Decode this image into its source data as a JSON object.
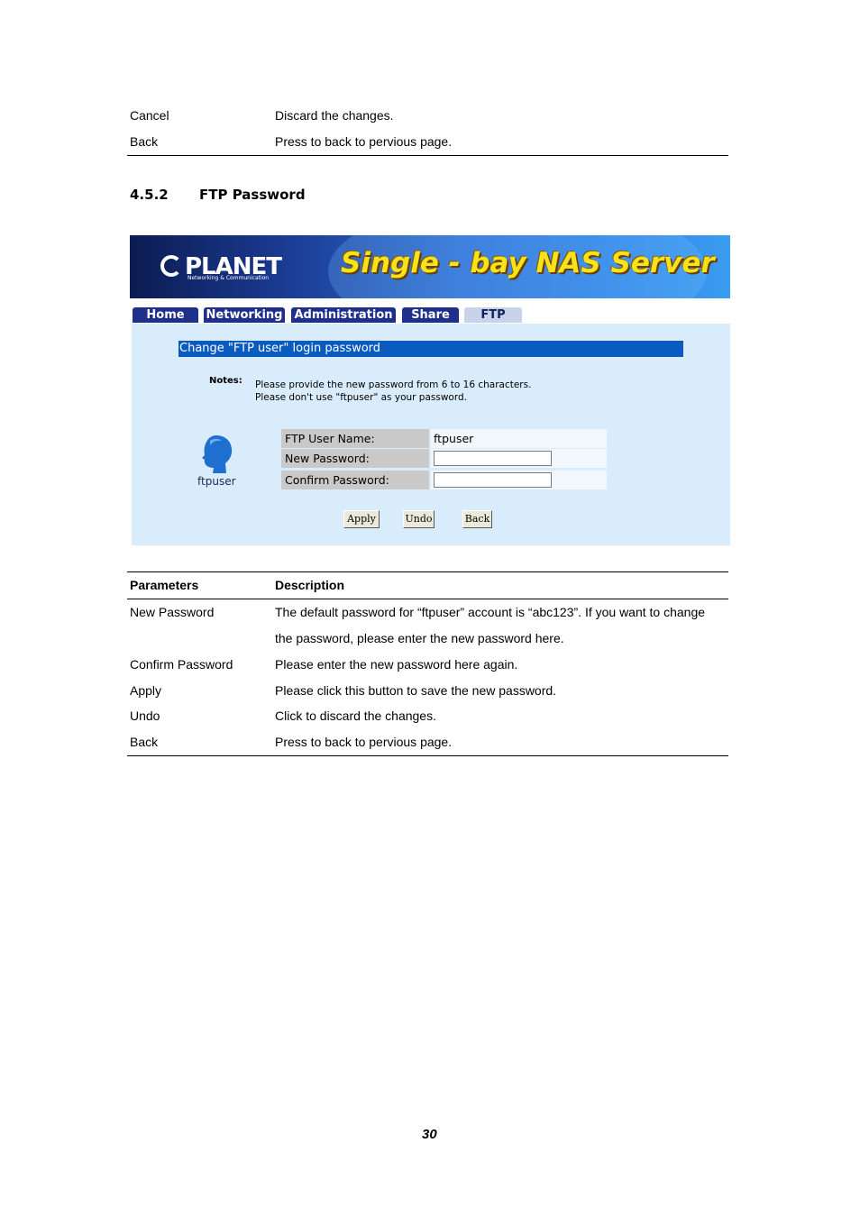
{
  "top_rows": [
    {
      "param": "Cancel",
      "desc": "Discard the changes."
    },
    {
      "param": "Back",
      "desc": "Press to back to pervious page."
    }
  ],
  "section": {
    "number": "4.5.2",
    "title": "FTP Password"
  },
  "screenshot": {
    "logo_text": "PLANET",
    "logo_subtext": "Networking & Communication",
    "banner_title": "Single - bay NAS Server",
    "tabs": [
      "Home",
      "Networking",
      "Administration",
      "Share",
      "FTP"
    ],
    "panel_title": "Change \"FTP user\" login password",
    "notes_label": "Notes:",
    "notes": [
      "Please provide the new password from 6 to 16 characters.",
      "Please don't use \"ftpuser\" as your password."
    ],
    "avatar_name": "ftpuser",
    "fields": {
      "user_name_label": "FTP User Name:",
      "user_name_value": "ftpuser",
      "new_password_label": "New Password:",
      "new_password_value": "",
      "confirm_password_label": "Confirm Password:",
      "confirm_password_value": ""
    },
    "buttons": {
      "apply": "Apply",
      "undo": "Undo",
      "back": "Back"
    }
  },
  "table": {
    "headers": [
      "Parameters",
      "Description"
    ],
    "rows": [
      {
        "param": "New Password",
        "desc": "The default password for “ftpuser” account is “abc123”. If you want to change",
        "desc2": "the password, please enter the new password here."
      },
      {
        "param": "Confirm Password",
        "desc": "Please enter the new password here again."
      },
      {
        "param": "Apply",
        "desc": "Please click this button to save the new password."
      },
      {
        "param": "Undo",
        "desc": "Click to discard the changes."
      },
      {
        "param": "Back",
        "desc": "Press to back to pervious page."
      }
    ]
  },
  "page_number": "30"
}
